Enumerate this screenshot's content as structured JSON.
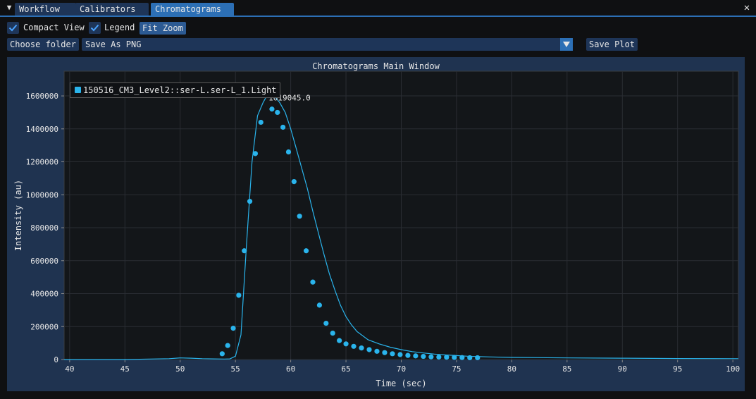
{
  "tabs": {
    "menu_icon": "triangle-down-icon",
    "items": [
      {
        "label": "Workflow"
      },
      {
        "label": "Calibrators"
      },
      {
        "label": "Chromatograms"
      }
    ],
    "close_icon": "close-icon"
  },
  "toolbar": {
    "compact_view_label": "Compact View",
    "compact_view_checked": true,
    "legend_label": "Legend",
    "legend_checked": true,
    "fit_zoom_label": "Fit Zoom",
    "choose_folder_label": "Choose folder",
    "save_format_value": "Save As PNG",
    "save_plot_label": "Save Plot"
  },
  "colors": {
    "accent": "#2c6fb5",
    "frame_bg": "#1e3558",
    "plot_bg": "#131619",
    "series": "#2ab4ec"
  },
  "chart_data": {
    "type": "line",
    "title": "Chromatograms Main Window",
    "xlabel": "Time (sec)",
    "ylabel": "Intensity (au)",
    "xlim": [
      39.5,
      100.5
    ],
    "ylim": [
      0,
      1750000
    ],
    "xticks": [
      40,
      45,
      50,
      55,
      60,
      65,
      70,
      75,
      80,
      85,
      90,
      95,
      100
    ],
    "yticks": [
      0,
      200000,
      400000,
      600000,
      800000,
      1000000,
      1200000,
      1400000,
      1600000
    ],
    "ytick_labels": [
      "0",
      "200000",
      "400000",
      "600000",
      "800000",
      "1000000",
      "1200000",
      "1400000",
      "1600000"
    ],
    "grid": true,
    "legend_position": "top-left",
    "series": [
      {
        "name": "150516_CM3_Level2::ser-L.ser-L_1.Light",
        "style": "line",
        "x": [
          39.5,
          45,
          49,
          50,
          51,
          52,
          53,
          54,
          54.5,
          55,
          55.5,
          56,
          56.5,
          57,
          57.5,
          58,
          58.5,
          59,
          59.5,
          60,
          60.5,
          61,
          61.5,
          62,
          62.5,
          63,
          63.5,
          64,
          64.5,
          65,
          65.5,
          66,
          67,
          68,
          69,
          70,
          71,
          72,
          73,
          74,
          75,
          76,
          77,
          78,
          80,
          85,
          90,
          95,
          100.5
        ],
        "y": [
          0,
          0,
          5000,
          10000,
          8000,
          5000,
          4000,
          3000,
          4000,
          20000,
          150000,
          700000,
          1200000,
          1480000,
          1560000,
          1619045,
          1600000,
          1560000,
          1500000,
          1400000,
          1280000,
          1160000,
          1040000,
          900000,
          770000,
          640000,
          520000,
          420000,
          330000,
          260000,
          210000,
          170000,
          120000,
          95000,
          75000,
          60000,
          48000,
          40000,
          33000,
          28000,
          24000,
          20000,
          18000,
          16000,
          13000,
          10000,
          8000,
          6000,
          5000
        ]
      },
      {
        "name": "150516_CM3_Level2::ser-L.ser-L_1.Light",
        "style": "points",
        "x": [
          53.8,
          54.3,
          54.8,
          55.3,
          55.8,
          56.3,
          56.8,
          57.3,
          57.8,
          58.3,
          58.8,
          59.3,
          59.8,
          60.3,
          60.8,
          61.4,
          62,
          62.6,
          63.2,
          63.8,
          64.4,
          65,
          65.7,
          66.4,
          67.1,
          67.8,
          68.5,
          69.2,
          69.9,
          70.6,
          71.3,
          72,
          72.7,
          73.4,
          74.1,
          74.8,
          75.5,
          76.2,
          76.9
        ],
        "y": [
          35000,
          85000,
          190000,
          390000,
          660000,
          960000,
          1250000,
          1440000,
          1620000,
          1520000,
          1500000,
          1410000,
          1260000,
          1080000,
          870000,
          660000,
          470000,
          330000,
          220000,
          160000,
          115000,
          95000,
          80000,
          70000,
          60000,
          50000,
          42000,
          35000,
          30000,
          25000,
          22000,
          19000,
          16000,
          15000,
          14000,
          13000,
          12000,
          11000,
          11000
        ]
      }
    ],
    "annotation": {
      "x": 57.8,
      "y": 1619045,
      "label": "1619045.0"
    }
  }
}
